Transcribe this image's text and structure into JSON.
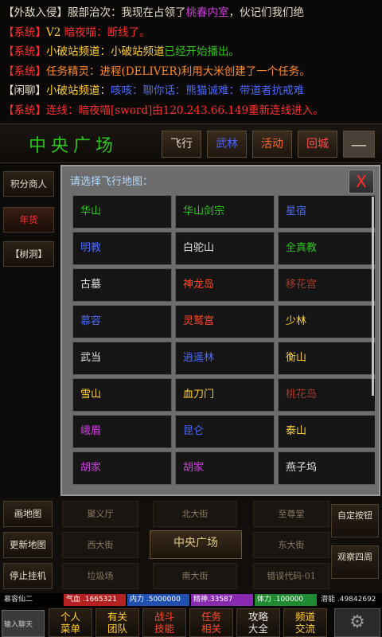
{
  "chat": [
    {
      "segments": [
        {
          "text": "【外敌入侵】",
          "color": "#e6dcc8"
        },
        {
          "text": "服部治次",
          "color": "#e6dcc8"
        },
        {
          "text": "：我现在占领了",
          "color": "#e6dcc8"
        },
        {
          "text": "桃春内室",
          "color": "#d040e0"
        },
        {
          "text": "，伙记们我们绝",
          "color": "#e6dcc8"
        }
      ]
    },
    {
      "segments": [
        {
          "text": "【系统】",
          "color": "#ff3030"
        },
        {
          "text": "V2 ",
          "color": "#ffd030"
        },
        {
          "text": "暗夜喵",
          "color": "#ff3030"
        },
        {
          "text": "：断线了。",
          "color": "#ff3030"
        }
      ]
    },
    {
      "segments": [
        {
          "text": "【系统】",
          "color": "#ff3030"
        },
        {
          "text": "小破站频道",
          "color": "#ffd030"
        },
        {
          "text": "：小破站频道",
          "color": "#ffd030"
        },
        {
          "text": "已经开始播出。",
          "color": "#2ec51b"
        }
      ]
    },
    {
      "segments": [
        {
          "text": "【系统】",
          "color": "#ff3030"
        },
        {
          "text": "任务精灵：进程(DELIVER)利用大米创建了一个任务。",
          "color": "#ff8a28"
        }
      ]
    },
    {
      "segments": [
        {
          "text": "【闲聊】",
          "color": "#e6dcc8"
        },
        {
          "text": "小破站频道",
          "color": "#ffd030"
        },
        {
          "text": "：",
          "color": "#e6dcc8"
        },
        {
          "text": "咳咳：聊你话：熊猫诚难：带道者抗戒难",
          "color": "#4a6aff"
        }
      ]
    },
    {
      "segments": [
        {
          "text": "【系统】",
          "color": "#ff3030"
        },
        {
          "text": "连线：暗夜喵[sword]由120.243.66.149重新连线进入。",
          "color": "#ff3030"
        }
      ]
    }
  ],
  "topbar": {
    "location": "中央广场",
    "buttons": {
      "fly": "飞行",
      "wulin": "武林",
      "activity": "活动",
      "return": "回城",
      "menu": "—"
    }
  },
  "left": {
    "trader": "积分商人",
    "shop": "年货",
    "cave": "【树洞】"
  },
  "dialog": {
    "title": "请选择飞行地图：",
    "close": "X",
    "maps": [
      {
        "name": "华山",
        "color": "#2ec51b"
      },
      {
        "name": "华山剑宗",
        "color": "#2ec51b"
      },
      {
        "name": "星宿",
        "color": "#4a6aff"
      },
      {
        "name": "明教",
        "color": "#4a6aff"
      },
      {
        "name": "白驼山",
        "color": "#e6e6e6"
      },
      {
        "name": "全真教",
        "color": "#2ec51b"
      },
      {
        "name": "古墓",
        "color": "#e6e6e6"
      },
      {
        "name": "神龙岛",
        "color": "#ff4a28"
      },
      {
        "name": "移花宫",
        "color": "#a03a2a"
      },
      {
        "name": "慕容",
        "color": "#4a6aff"
      },
      {
        "name": "灵鹫宫",
        "color": "#ff4a28"
      },
      {
        "name": "少林",
        "color": "#ffd030"
      },
      {
        "name": "武当",
        "color": "#e6e6e6"
      },
      {
        "name": "逍遥林",
        "color": "#4a6aff"
      },
      {
        "name": "衡山",
        "color": "#ffd030"
      },
      {
        "name": "雪山",
        "color": "#ffd030"
      },
      {
        "name": "血刀门",
        "color": "#ffd030"
      },
      {
        "name": "桃花岛",
        "color": "#a03a2a"
      },
      {
        "name": "峨眉",
        "color": "#d040e0"
      },
      {
        "name": "昆仑",
        "color": "#4a6aff"
      },
      {
        "name": "泰山",
        "color": "#ffd030"
      },
      {
        "name": "胡家",
        "color": "#d040e0"
      },
      {
        "name": "胡家",
        "color": "#d040e0"
      },
      {
        "name": "燕子坞",
        "color": "#e6e6e6"
      }
    ]
  },
  "bottom": {
    "left_buttons": [
      "画地图",
      "更新地图",
      "停止挂机"
    ],
    "nav": {
      "nw": "聚义厅",
      "n": "北大街",
      "ne": "至尊堂",
      "w": "西大街",
      "center": "中央广场",
      "e": "东大街",
      "sw": "垃圾场",
      "s": "南大街",
      "se": "错误代码·01"
    },
    "right_buttons": [
      "自定按钮",
      "观察四周"
    ]
  },
  "status": {
    "name": "慕容仙二",
    "qi": "气血 .1665321",
    "neili": "内力 .5000000",
    "jingshen": "精神.33587",
    "tili": "体力 .100000",
    "qianneng": "潜能 .49842692"
  },
  "footer": {
    "input": "输入聊天",
    "tabs": [
      {
        "label": "个人\n菜单",
        "color": "#ffd030"
      },
      {
        "label": "有关\n团队",
        "color": "#ffd030"
      },
      {
        "label": "战斗\n技能",
        "color": "#ff4a28"
      },
      {
        "label": "任务\n相关",
        "color": "#ff4a28"
      },
      {
        "label": "攻略\n大全",
        "color": "#e6e6e6"
      },
      {
        "label": "频道\n交流",
        "color": "#ffd030"
      }
    ],
    "gear": "⚙"
  }
}
